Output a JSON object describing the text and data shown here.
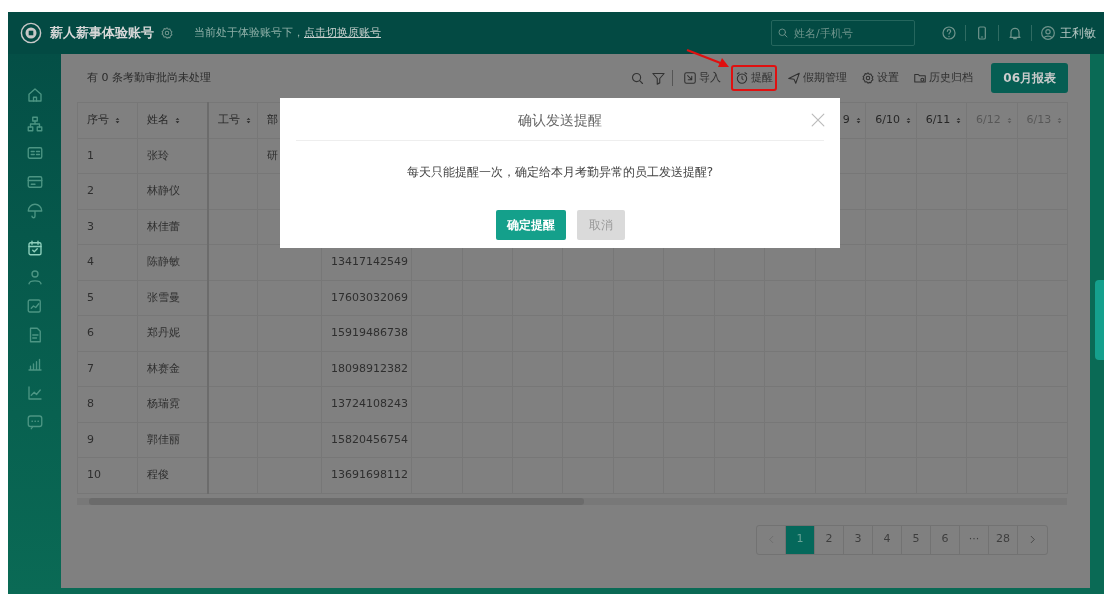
{
  "header": {
    "title": "薪人薪事体验账号",
    "notice": "当前处于体验账号下，",
    "switch_link": "点击切换原账号",
    "search": {
      "placeholder": "姓名/手机号"
    },
    "user": "王利敏"
  },
  "sidebar": {
    "items": [
      {
        "selected": false
      },
      {
        "selected": false
      },
      {
        "selected": false
      },
      {
        "selected": false
      },
      {
        "selected": false
      },
      {
        "selected": true
      },
      {
        "selected": false
      },
      {
        "selected": false
      },
      {
        "selected": false
      },
      {
        "selected": false
      },
      {
        "selected": false
      },
      {
        "selected": false
      }
    ]
  },
  "toolbar": {
    "pending": "有 0 条考勤审批尚未处理",
    "actions": [
      {
        "label": "导入",
        "highlighted": false
      },
      {
        "label": "提醒",
        "highlighted": true
      },
      {
        "label": "假期管理",
        "highlighted": false
      },
      {
        "label": "设置",
        "highlighted": false
      },
      {
        "label": "历史归档",
        "highlighted": false
      }
    ],
    "report_button": "06月报表"
  },
  "table": {
    "columns": [
      {
        "label": "序号",
        "muted": false
      },
      {
        "label": "姓名",
        "muted": false
      },
      {
        "label": "工号",
        "muted": false
      },
      {
        "label": "部",
        "muted": false
      },
      {},
      {},
      {},
      {},
      {},
      {},
      {},
      {},
      {},
      {
        "label": "9",
        "muted": false
      },
      {
        "label": "6/10",
        "muted": false
      },
      {
        "label": "6/11",
        "muted": false
      },
      {
        "label": "6/12",
        "muted": true
      },
      {
        "label": "6/13",
        "muted": true
      }
    ],
    "rows": [
      {
        "no": "1",
        "name": "张玲",
        "dept": "研"
      },
      {
        "no": "2",
        "name": "林静仪"
      },
      {
        "no": "3",
        "name": "林佳蕾"
      },
      {
        "no": "4",
        "name": "陈静敏",
        "phone": "13417142549"
      },
      {
        "no": "5",
        "name": "张雪曼",
        "phone": "17603032069"
      },
      {
        "no": "6",
        "name": "郑丹妮",
        "phone": "15919486738"
      },
      {
        "no": "7",
        "name": "林赛金",
        "phone": "18098912382"
      },
      {
        "no": "8",
        "name": "杨瑞霓",
        "phone": "13724108243"
      },
      {
        "no": "9",
        "name": "郭佳丽",
        "phone": "15820456754"
      },
      {
        "no": "10",
        "name": "程俊",
        "phone": "13691698112"
      }
    ]
  },
  "pagination": {
    "pages": [
      {
        "label": "1",
        "selected": true
      },
      {
        "label": "2",
        "selected": false
      },
      {
        "label": "3",
        "selected": false
      },
      {
        "label": "4",
        "selected": false
      },
      {
        "label": "5",
        "selected": false
      },
      {
        "label": "6",
        "selected": false
      },
      {
        "label": "···",
        "selected": false
      },
      {
        "label": "28",
        "selected": false
      }
    ]
  },
  "modal": {
    "title": "确认发送提醒",
    "message": "每天只能提醒一次，确定给本月考勤异常的员工发送提醒?",
    "confirm": "确定提醒",
    "cancel": {
      "label": "取消",
      "disabled": true
    }
  }
}
